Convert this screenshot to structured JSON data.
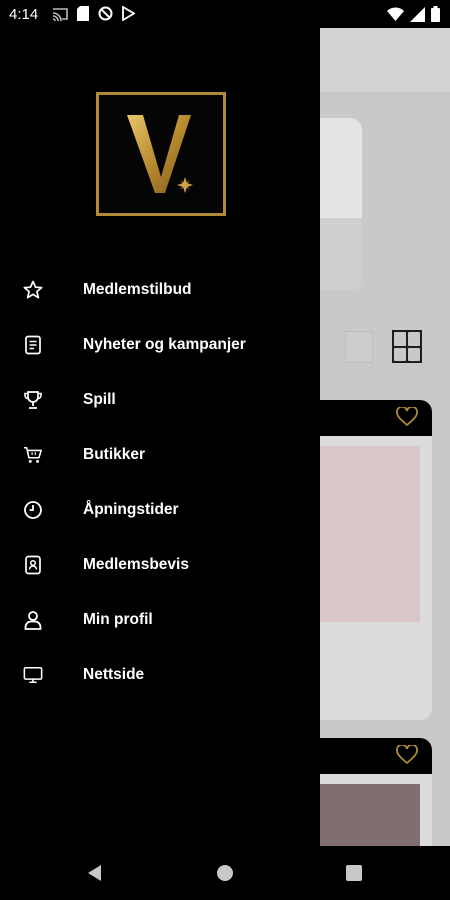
{
  "status_bar": {
    "time": "4:14",
    "left_icons": [
      "cast-icon",
      "sd-card-icon",
      "blocked-icon",
      "play-store-icon"
    ],
    "right_icons": [
      "wifi-icon",
      "signal-icon",
      "battery-icon"
    ]
  },
  "drawer": {
    "logo_icon": "v-star-logo",
    "accent_color": "#b08a36",
    "items": [
      {
        "label": "Medlemstilbud",
        "icon": "star-icon"
      },
      {
        "label": "Nyheter og kampanjer",
        "icon": "news-icon"
      },
      {
        "label": "Spill",
        "icon": "trophy-icon"
      },
      {
        "label": "Butikker",
        "icon": "cart-icon"
      },
      {
        "label": "Åpningstider",
        "icon": "clock-icon"
      },
      {
        "label": "Medlemsbevis",
        "icon": "member-card-icon"
      },
      {
        "label": "Min profil",
        "icon": "person-icon"
      },
      {
        "label": "Nettside",
        "icon": "monitor-icon"
      }
    ]
  },
  "navigation_bar": {
    "buttons": [
      "back-icon",
      "home-icon",
      "recents-icon"
    ]
  }
}
